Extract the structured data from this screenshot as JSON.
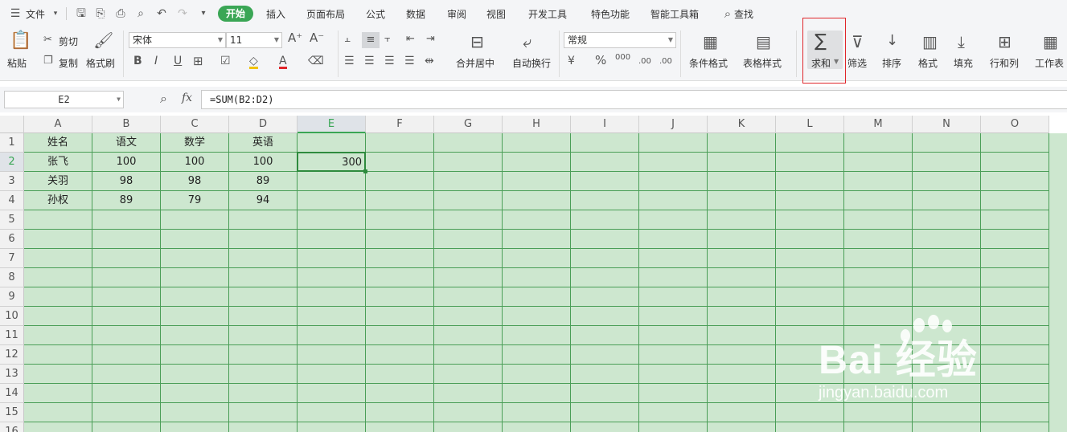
{
  "menu": {
    "file": "文件",
    "tabs": [
      "开始",
      "插入",
      "页面布局",
      "公式",
      "数据",
      "审阅",
      "视图",
      "开发工具",
      "特色功能",
      "智能工具箱"
    ],
    "active_tab": "开始",
    "search": "查找"
  },
  "ribbon": {
    "paste": "粘贴",
    "cut": "剪切",
    "copy": "复制",
    "format_painter": "格式刷",
    "font_name": "宋体",
    "font_size": "11",
    "merge_center": "合并居中",
    "wrap_text": "自动换行",
    "number_format": "常规",
    "conditional_format": "条件格式",
    "table_style": "表格样式",
    "sum": "求和",
    "filter": "筛选",
    "sort": "排序",
    "format": "格式",
    "fill": "填充",
    "rows_cols": "行和列",
    "worksheet": "工作表",
    "percent": "%",
    "thousands": "000",
    "inc_decimal": ".00",
    "dec_decimal": ".00",
    "fx": "fx"
  },
  "formula_bar": {
    "name_box": "E2",
    "formula": "=SUM(B2:D2)"
  },
  "grid": {
    "columns": [
      "A",
      "B",
      "C",
      "D",
      "E",
      "F",
      "G",
      "H",
      "I",
      "J",
      "K",
      "L",
      "M",
      "N",
      "O"
    ],
    "rows": [
      "1",
      "2",
      "3",
      "4",
      "5",
      "6",
      "7",
      "8",
      "9",
      "10",
      "11",
      "12",
      "13",
      "14",
      "15",
      "16"
    ],
    "selected_column": "E",
    "selected_row": "2",
    "data": [
      [
        "姓名",
        "语文",
        "数学",
        "英语",
        ""
      ],
      [
        "张飞",
        "100",
        "100",
        "100",
        "300"
      ],
      [
        "关羽",
        "98",
        "98",
        "89",
        ""
      ],
      [
        "孙权",
        "89",
        "79",
        "94",
        ""
      ]
    ]
  },
  "watermark": {
    "logo": "Bai 经验",
    "site": "jingyan.baidu.com"
  },
  "colors": {
    "accent": "#3aa655",
    "grid_fill": "#cde7cf",
    "grid_line": "#4a9e57",
    "highlight_box": "#e0262b"
  }
}
